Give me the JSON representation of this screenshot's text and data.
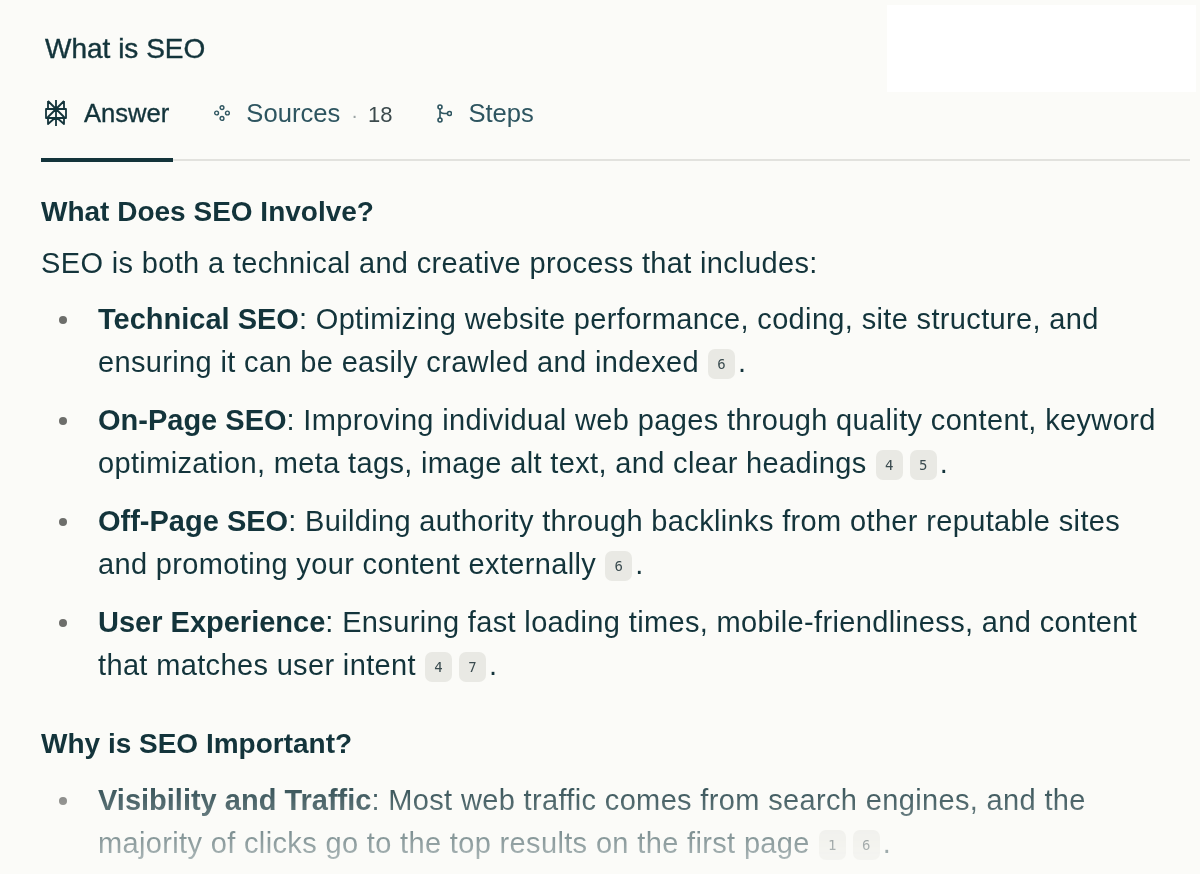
{
  "page": {
    "title": "What is SEO"
  },
  "tabs": [
    {
      "kind": "answer",
      "label": "Answer",
      "selected": true
    },
    {
      "kind": "sources",
      "label": "Sources",
      "separator": "·",
      "count": "18",
      "selected": false
    },
    {
      "kind": "steps",
      "label": "Steps",
      "selected": false
    }
  ],
  "sections": [
    {
      "heading": "What Does SEO Involve?",
      "intro": "SEO is both a technical and creative process that includes:",
      "items": [
        {
          "text": "**Technical SEO**: Optimizing website performance, coding, site structure, and ensuring it can be easily crawled and indexed",
          "citations": [
            "6"
          ],
          "end": "."
        },
        {
          "text": "**On-Page SEO**: Improving individual web pages through quality content, keyword optimization, meta tags, image alt text, and clear headings",
          "citations": [
            "4",
            "5"
          ],
          "end": "."
        },
        {
          "text": "**Off-Page SEO**: Building authority through backlinks from other reputable sites and promoting your content externally",
          "citations": [
            "6"
          ],
          "end": "."
        },
        {
          "text": "**User Experience**: Ensuring fast loading times, mobile-friendliness, and content that matches user intent",
          "citations": [
            "4",
            "7"
          ],
          "end": "."
        }
      ]
    },
    {
      "heading": "Why is SEO Important?",
      "items": [
        {
          "text": "**Visibility and Traffic**: Most web traffic comes from search engines, and the majority of clicks go to the top results on the first page",
          "citations": [
            "1",
            "6"
          ],
          "end": "."
        }
      ]
    }
  ]
}
